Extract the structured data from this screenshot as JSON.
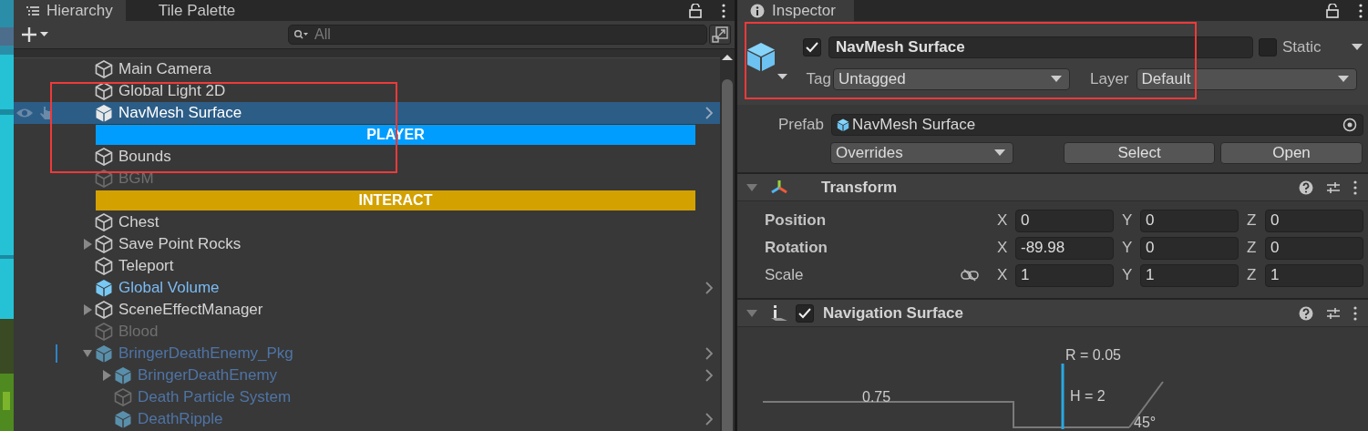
{
  "hierarchy": {
    "tabs": [
      {
        "label": "Hierarchy",
        "selected": true
      },
      {
        "label": "Tile Palette",
        "selected": false
      }
    ],
    "search": {
      "placeholder": "All"
    },
    "annotated": true,
    "rows": [
      {
        "kind": "object",
        "name": "Main Camera",
        "prefab": false,
        "active": true,
        "selected": false,
        "chevron": false,
        "edited": false
      },
      {
        "kind": "object",
        "name": "Global Light 2D",
        "prefab": false,
        "active": true,
        "selected": false,
        "chevron": false,
        "edited": false
      },
      {
        "kind": "prefab",
        "name": "NavMesh Surface",
        "prefab": false,
        "active": true,
        "selected": true,
        "chevron": true,
        "edited": false
      },
      {
        "kind": "header",
        "name": "PLAYER",
        "color": "#009dff"
      },
      {
        "kind": "object",
        "name": "Bounds",
        "prefab": false,
        "active": true,
        "selected": false,
        "chevron": false,
        "edited": false
      },
      {
        "kind": "object",
        "name": "BGM",
        "prefab": false,
        "active": false,
        "selected": false,
        "chevron": false,
        "edited": false
      },
      {
        "kind": "header",
        "name": "INTERACT",
        "color": "#d3a100"
      },
      {
        "kind": "object",
        "name": "Chest",
        "prefab": false,
        "active": true,
        "selected": false,
        "chevron": false,
        "edited": false
      },
      {
        "kind": "object",
        "name": "Save Point Rocks",
        "prefab": false,
        "active": true,
        "selected": false,
        "expanded": false,
        "chevron": false,
        "edited": false
      },
      {
        "kind": "object",
        "name": "Teleport",
        "prefab": false,
        "active": true,
        "selected": false,
        "chevron": false,
        "edited": false
      },
      {
        "kind": "prefab",
        "name": "Global Volume",
        "prefab": true,
        "active": true,
        "selected": false,
        "chevron": true,
        "edited": false
      },
      {
        "kind": "object",
        "name": "SceneEffectManager",
        "prefab": false,
        "active": true,
        "selected": false,
        "expanded": false,
        "chevron": false,
        "edited": false
      },
      {
        "kind": "object",
        "name": "Blood",
        "prefab": false,
        "active": false,
        "selected": false,
        "chevron": false,
        "edited": false
      },
      {
        "kind": "prefab",
        "name": "BringerDeathEnemy_Pkg",
        "prefab": true,
        "active": false,
        "selected": false,
        "expanded": true,
        "chevron": true,
        "edited": true,
        "children": [
          {
            "kind": "prefab",
            "name": "BringerDeathEnemy",
            "prefab": true,
            "active": false,
            "selected": false,
            "expanded": false,
            "chevron": true,
            "edited": false
          },
          {
            "kind": "object",
            "name": "Death Particle System",
            "prefab": true,
            "active": false,
            "selected": false,
            "chevron": false,
            "edited": false
          },
          {
            "kind": "prefab",
            "name": "DeathRipple",
            "prefab": true,
            "active": false,
            "selected": false,
            "chevron": true,
            "edited": false
          }
        ]
      }
    ]
  },
  "inspector": {
    "tab": "Inspector",
    "annotated": true,
    "object": {
      "enabled": true,
      "name": "NavMesh Surface",
      "static": false,
      "static_label": "Static",
      "tag_label": "Tag",
      "tag": "Untagged",
      "layer_label": "Layer",
      "layer": "Default"
    },
    "prefab": {
      "label": "Prefab",
      "asset": "NavMesh Surface",
      "overrides": "Overrides",
      "buttons": [
        "Select",
        "Open"
      ]
    },
    "components": [
      {
        "kind": "transform",
        "title": "Transform",
        "expanded": true,
        "rows": [
          {
            "label": "Position",
            "bold": true,
            "link": false,
            "fields": [
              {
                "axis": "X",
                "value": "0"
              },
              {
                "axis": "Y",
                "value": "0"
              },
              {
                "axis": "Z",
                "value": "0"
              }
            ]
          },
          {
            "label": "Rotation",
            "bold": true,
            "link": false,
            "fields": [
              {
                "axis": "X",
                "value": "-89.98"
              },
              {
                "axis": "Y",
                "value": "0"
              },
              {
                "axis": "Z",
                "value": "0"
              }
            ]
          },
          {
            "label": "Scale",
            "bold": false,
            "link": true,
            "fields": [
              {
                "axis": "X",
                "value": "1"
              },
              {
                "axis": "Y",
                "value": "1"
              },
              {
                "axis": "Z",
                "value": "1"
              }
            ]
          }
        ]
      },
      {
        "kind": "navigation",
        "title": "Navigation Surface",
        "expanded": true,
        "enabled": true,
        "diagram": {
          "radius": "R = 0.05",
          "height": "H = 2",
          "step": "0.75",
          "slope": "45°"
        }
      }
    ]
  }
}
